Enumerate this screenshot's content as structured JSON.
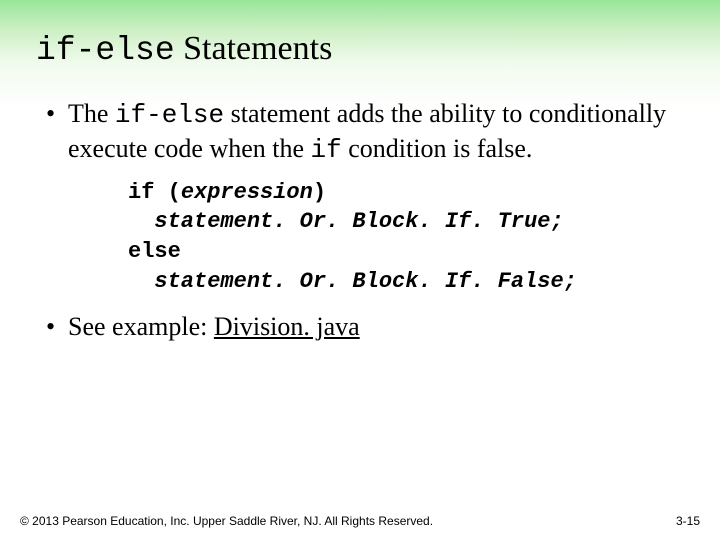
{
  "title": {
    "mono": "if-else",
    "rest": " Statements"
  },
  "bullet1": {
    "lead": "The ",
    "mono": "if-else",
    "mid": " statement adds the ability to conditionally execute code when the ",
    "mono2": "if",
    "tail": " condition is false."
  },
  "code": {
    "l1a": "if (",
    "l1b": "expression",
    "l1c": ")",
    "l2": "  statement. Or. Block. If. True;",
    "l3": "else",
    "l4": "  statement. Or. Block. If. False;"
  },
  "bullet2": {
    "lead": "See example: ",
    "link": "Division. java"
  },
  "footer": "© 2013 Pearson Education, Inc. Upper Saddle River, NJ. All Rights Reserved.",
  "pagenum": "3-15"
}
